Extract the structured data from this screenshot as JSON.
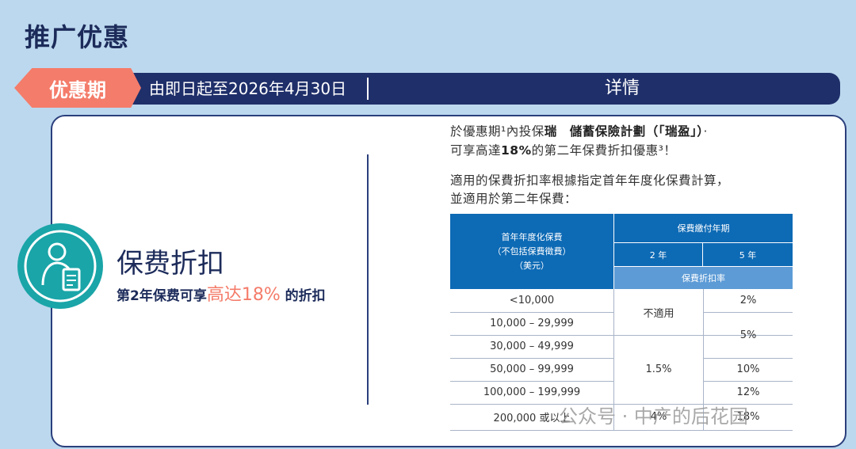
{
  "page_title": "推广优惠",
  "banner": {
    "tag": "优惠期",
    "period": "由即日起至2026年4月30日",
    "details": "详情"
  },
  "benefit": {
    "icon": "advisor-document-icon",
    "title": "保费折扣",
    "subtitle_prefix": "第2年保费可享",
    "subtitle_highlight": "高达18%",
    "subtitle_suffix": " 的折扣"
  },
  "description": {
    "line1_a": "於優惠期¹內投保",
    "line1_b": "瑞　儲蓄保險計劃（「瑞盈」）",
    "line1_c": "·",
    "line2_a": "可享高達",
    "line2_b": "18%",
    "line2_c": "的第二年保費折扣優惠³！",
    "line3": "適用的保費折扣率根據指定首年年度化保費計算，",
    "line4": "並適用於第二年保費："
  },
  "table": {
    "header_col1": [
      "首年年度化保費",
      "（不包括保費徵費）",
      "（美元）"
    ],
    "header_group": "保費繳付年期",
    "header_2yr": "2 年",
    "header_5yr": "5 年",
    "header_rate": "保費折扣率",
    "rows": [
      "<10,000",
      "10,000 – 29,999",
      "30,000 – 49,999",
      "50,000 – 99,999",
      "100,000 – 199,999",
      "200,000 或以上"
    ],
    "two_year": {
      "na": "不適用",
      "mid": "1.5%",
      "top": "4%"
    },
    "five_year": {
      "r1": "2%",
      "r2": "5%",
      "r3": "10%",
      "r4": "12%",
      "r5": "18%"
    }
  },
  "watermark": "公众号 · 中产的后花园"
}
